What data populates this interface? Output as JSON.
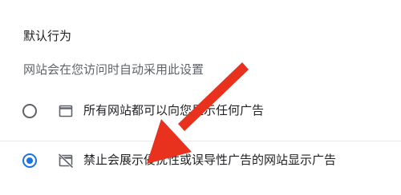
{
  "section": {
    "title": "默认行为",
    "description": "网站会在您访问时自动采用此设置"
  },
  "options": [
    {
      "label": "所有网站都可以向您显示任何广告",
      "icon": "browser-window-icon",
      "selected": false
    },
    {
      "label": "禁止会展示侵扰性或误导性广告的网站显示广告",
      "icon": "blocked-ads-icon",
      "selected": true
    }
  ],
  "annotation": {
    "icon": "red-arrow-pointer-icon",
    "color": "#e8321e"
  },
  "colors": {
    "accent": "#1a73e8",
    "text": "#202124",
    "secondary_text": "#5f6368"
  }
}
